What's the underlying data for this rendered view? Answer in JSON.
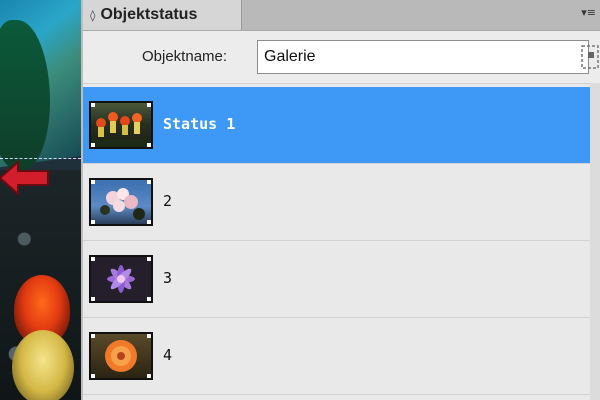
{
  "panel": {
    "tab_title": "Objektstatus",
    "tab_icon": "up-down-arrows-icon",
    "menu_icon": "panel-menu-icon"
  },
  "object_name": {
    "label": "Objektname:",
    "value": "Galerie",
    "select_icon": "select-content-icon"
  },
  "states": [
    {
      "label": "Status 1",
      "selected": true,
      "thumbnail": "red-yellow-flowers"
    },
    {
      "label": "2",
      "selected": false,
      "thumbnail": "pink-blossoms-blue-sky"
    },
    {
      "label": "3",
      "selected": false,
      "thumbnail": "purple-daisy"
    },
    {
      "label": "4",
      "selected": false,
      "thumbnail": "orange-flower"
    }
  ],
  "colors": {
    "selection": "#3d99f5",
    "panel_bg": "#e9e9e9",
    "tab_bg": "#d6d6d6",
    "arrow": "#d21e2a"
  }
}
